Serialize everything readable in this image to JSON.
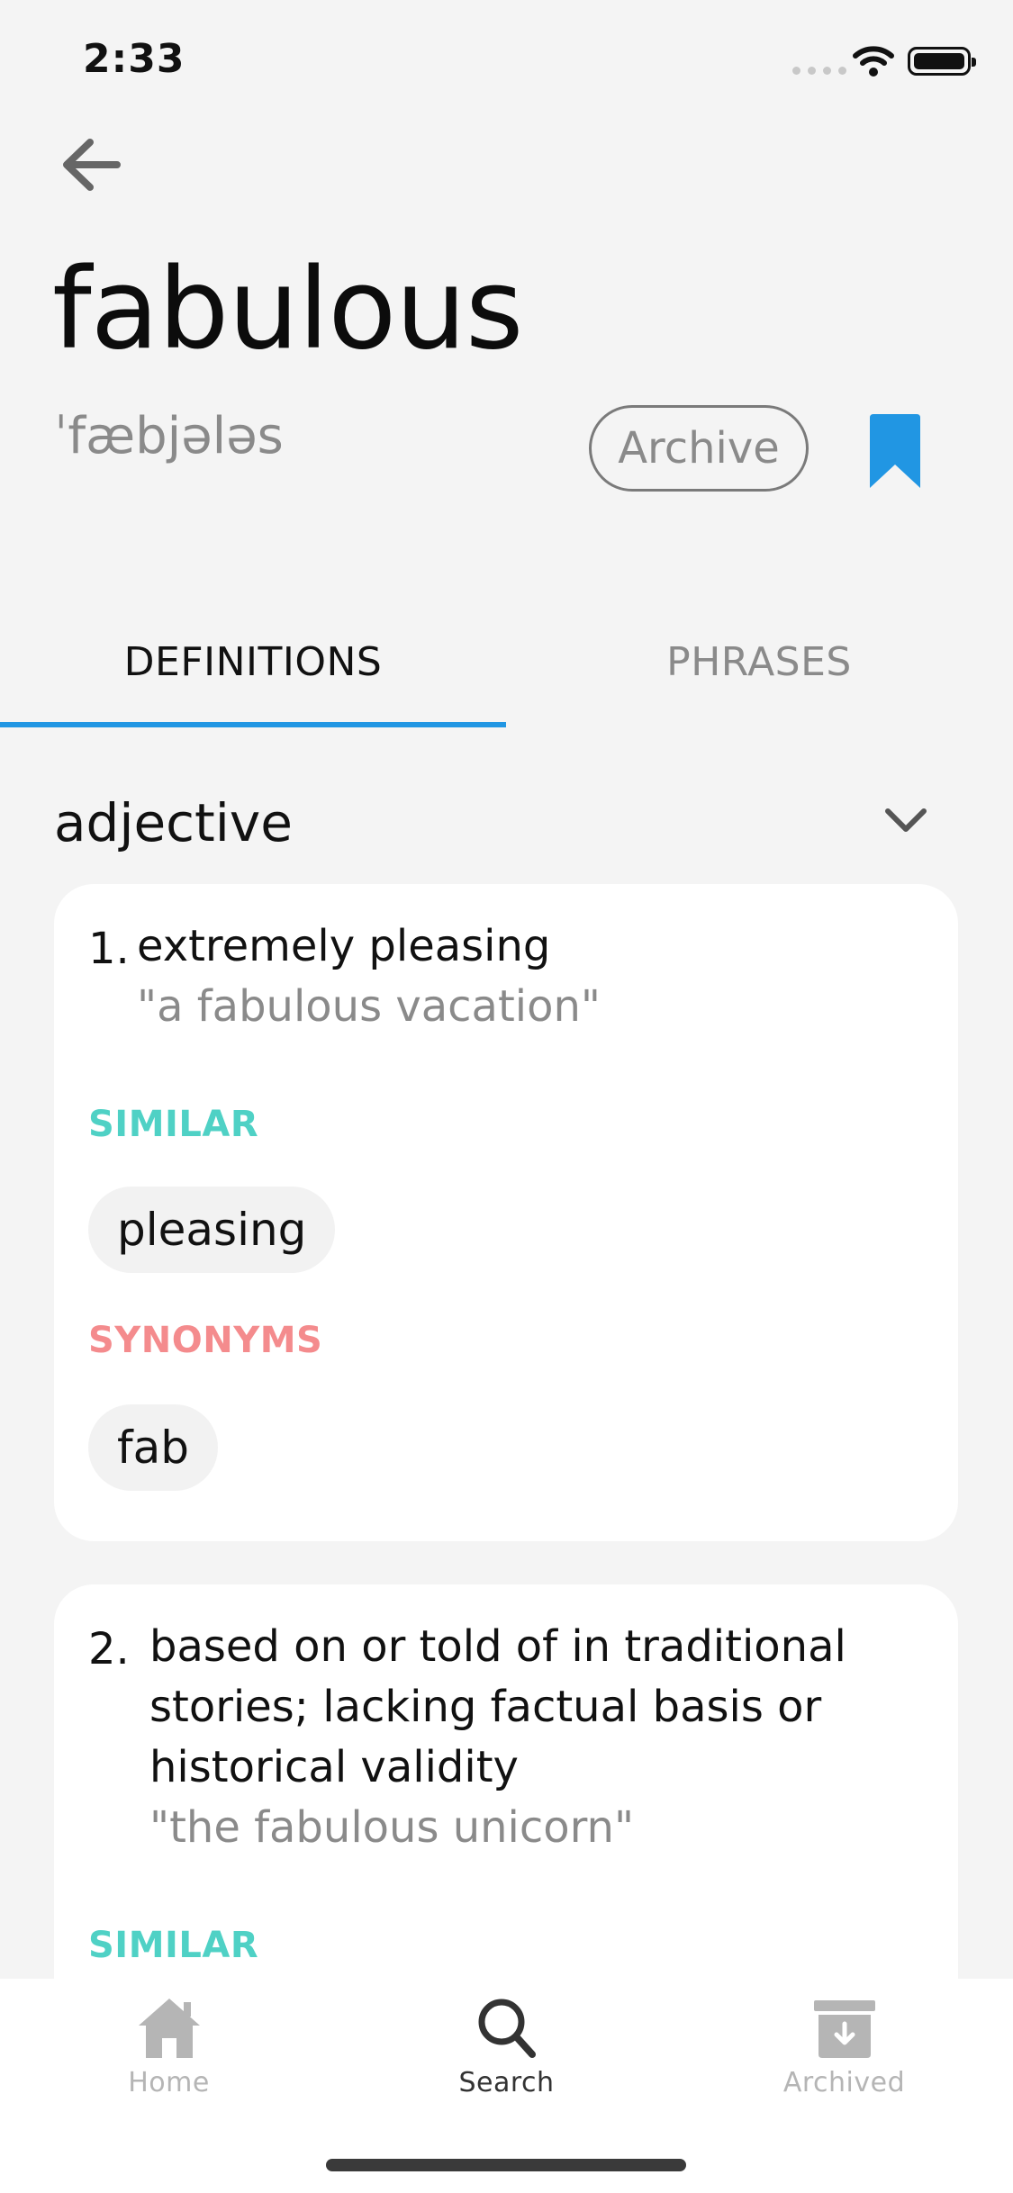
{
  "status_bar": {
    "time": "2:33"
  },
  "entry": {
    "word": "fabulous",
    "phonetic": "ˈfæbjələs",
    "archive_label": "Archive"
  },
  "tabs": [
    {
      "label": "DEFINITIONS",
      "active": true
    },
    {
      "label": "PHRASES",
      "active": false
    }
  ],
  "part_of_speech": "adjective",
  "definitions": [
    {
      "number": "1.",
      "text": "extremely pleasing",
      "example": "\"a fabulous vacation\"",
      "similar_label": "SIMILAR",
      "similar": [
        "pleasing"
      ],
      "synonyms_label": "SYNONYMS",
      "synonyms": [
        "fab"
      ]
    },
    {
      "number": "2.",
      "text_lines": [
        "based on or told of in traditional",
        "stories; lacking factual basis or",
        "historical validity"
      ],
      "example": "\"the fabulous unicorn\"",
      "similar_label": "SIMILAR"
    }
  ],
  "bottom_nav": [
    {
      "label": "Home",
      "icon": "home-icon",
      "active": false
    },
    {
      "label": "Search",
      "icon": "search-icon",
      "active": true
    },
    {
      "label": "Archived",
      "icon": "archive-box-icon",
      "active": false
    }
  ],
  "colors": {
    "accent": "#2196e3",
    "similar": "#4fd1c5",
    "synonyms": "#f48b8d",
    "nav_active": "#333333",
    "nav_inactive": "#b5b5b5"
  }
}
